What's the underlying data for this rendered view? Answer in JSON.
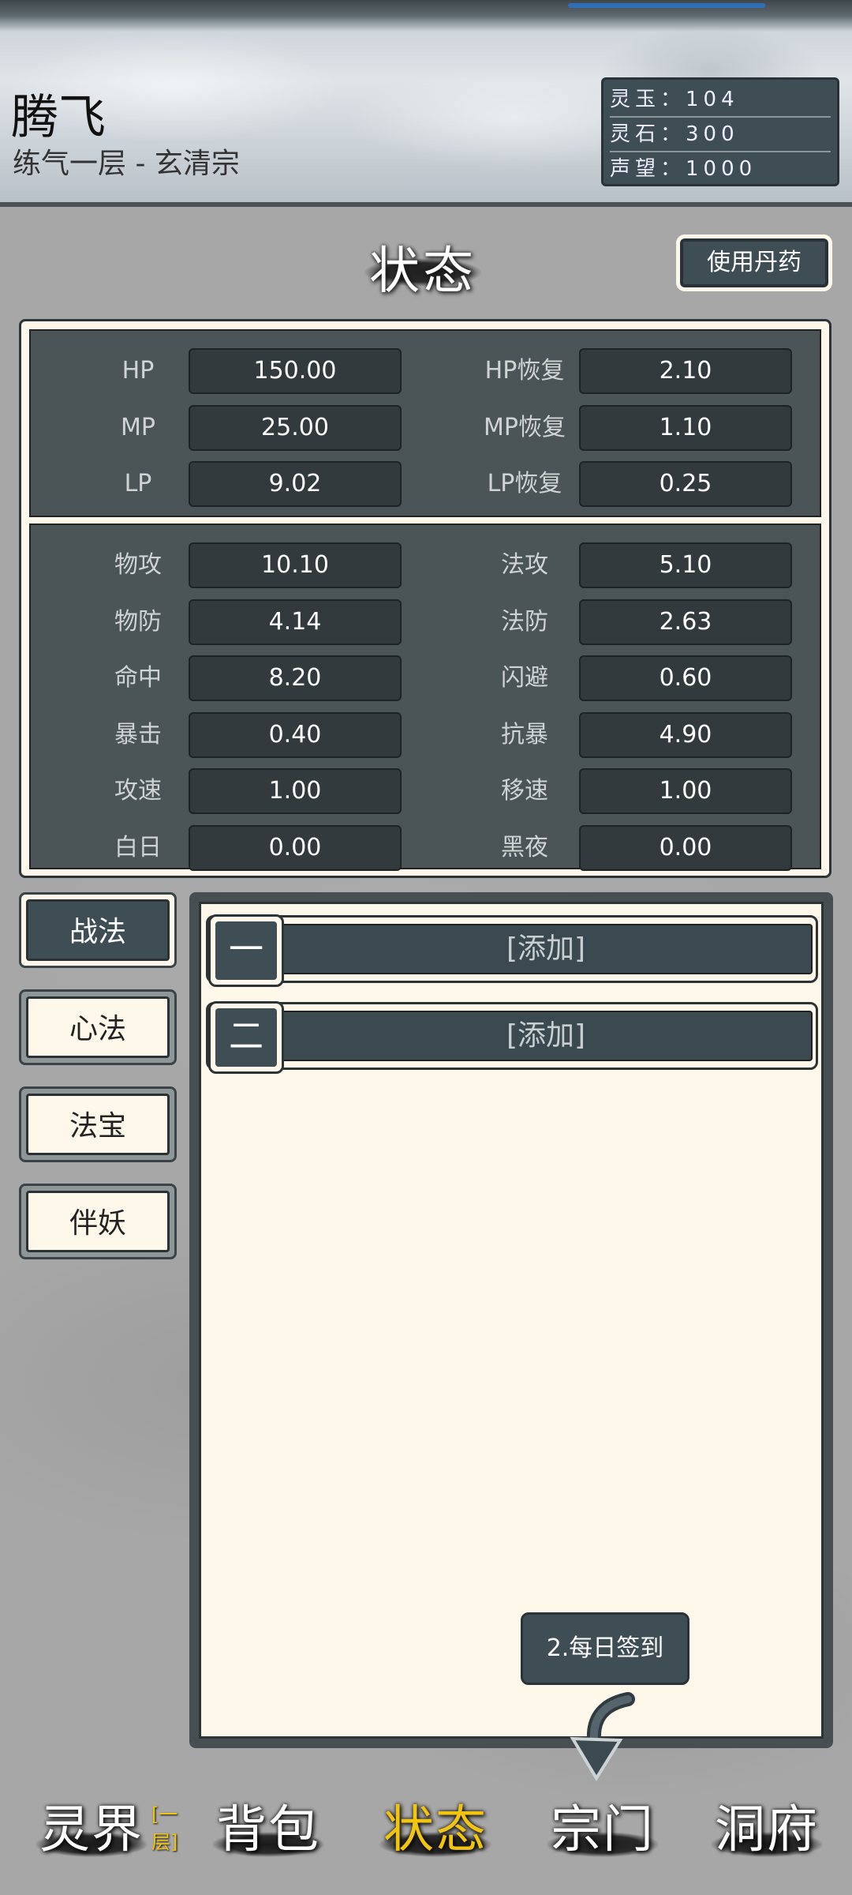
{
  "player": {
    "name": "腾飞",
    "subtitle": "练气一层 - 玄清宗"
  },
  "resources": [
    "灵玉：104",
    "灵石：300",
    "声望：1000"
  ],
  "title": "状态",
  "use_pill": "使用丹药",
  "stats_primary": [
    {
      "l_label": "HP",
      "l_value": "150.00",
      "r_label": "HP恢复",
      "r_value": "2.10"
    },
    {
      "l_label": "MP",
      "l_value": "25.00",
      "r_label": "MP恢复",
      "r_value": "1.10"
    },
    {
      "l_label": "LP",
      "l_value": "9.02",
      "r_label": "LP恢复",
      "r_value": "0.25"
    }
  ],
  "stats_secondary": [
    {
      "l_label": "物攻",
      "l_value": "10.10",
      "r_label": "法攻",
      "r_value": "5.10"
    },
    {
      "l_label": "物防",
      "l_value": "4.14",
      "r_label": "法防",
      "r_value": "2.63"
    },
    {
      "l_label": "命中",
      "l_value": "8.20",
      "r_label": "闪避",
      "r_value": "0.60"
    },
    {
      "l_label": "暴击",
      "l_value": "0.40",
      "r_label": "抗暴",
      "r_value": "4.90"
    },
    {
      "l_label": "攻速",
      "l_value": "1.00",
      "r_label": "移速",
      "r_value": "1.00"
    },
    {
      "l_label": "白日",
      "l_value": "0.00",
      "r_label": "黑夜",
      "r_value": "0.00"
    }
  ],
  "tabs": [
    "战法",
    "心法",
    "法宝",
    "伴妖"
  ],
  "slots": [
    {
      "num": "一",
      "label": "[添加]"
    },
    {
      "num": "二",
      "label": "[添加]"
    }
  ],
  "tip": "2.每日签到",
  "nav": [
    {
      "label": "灵界",
      "badge": "[一层]"
    },
    {
      "label": "背包"
    },
    {
      "label": "状态"
    },
    {
      "label": "宗门"
    },
    {
      "label": "洞府"
    }
  ],
  "colors": {
    "panel": "#4b5558",
    "accent": "#f1c40f",
    "cream": "#fdf8ea"
  }
}
